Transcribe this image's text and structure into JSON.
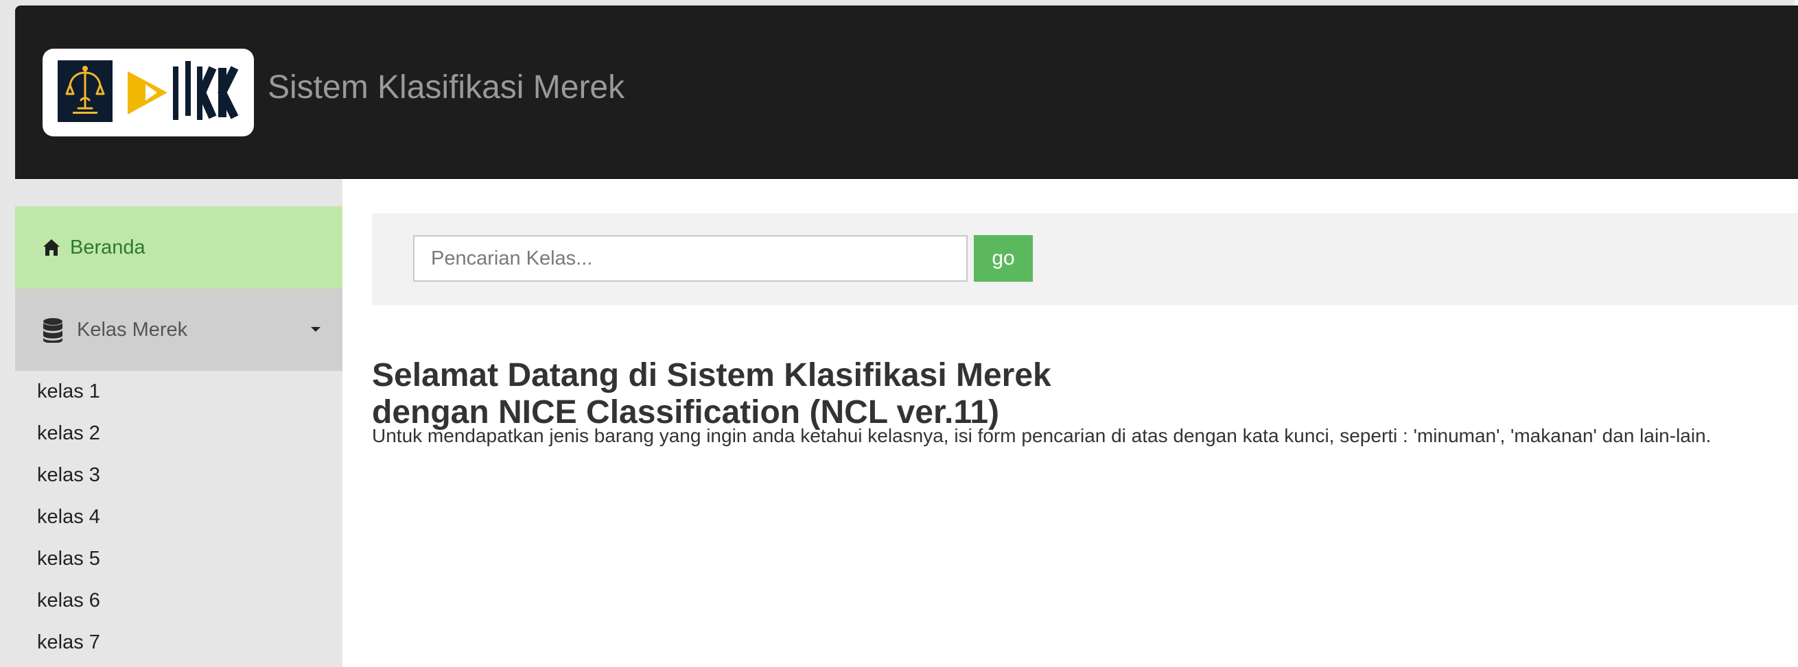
{
  "header": {
    "app_title": "Sistem Klasifikasi Merek"
  },
  "sidebar": {
    "home_label": "Beranda",
    "kelas_label": "Kelas Merek",
    "items": [
      {
        "label": "kelas 1"
      },
      {
        "label": "kelas 2"
      },
      {
        "label": "kelas 3"
      },
      {
        "label": "kelas 4"
      },
      {
        "label": "kelas 5"
      },
      {
        "label": "kelas 6"
      },
      {
        "label": "kelas 7"
      }
    ]
  },
  "search": {
    "placeholder": "Pencarian Kelas...",
    "value": "",
    "button_label": "go"
  },
  "main": {
    "title_line1": "Selamat Datang di Sistem Klasifikasi Merek",
    "title_line2": "dengan NICE Classification (NCL ver.11)",
    "description": "Untuk mendapatkan jenis barang yang ingin anda ketahui kelasnya, isi form pencarian di atas dengan kata kunci, seperti : 'minuman', 'makanan' dan lain-lain."
  },
  "icons": {
    "home": "home-icon",
    "kelas": "database-icon",
    "dropdown": "caret-down-icon"
  }
}
